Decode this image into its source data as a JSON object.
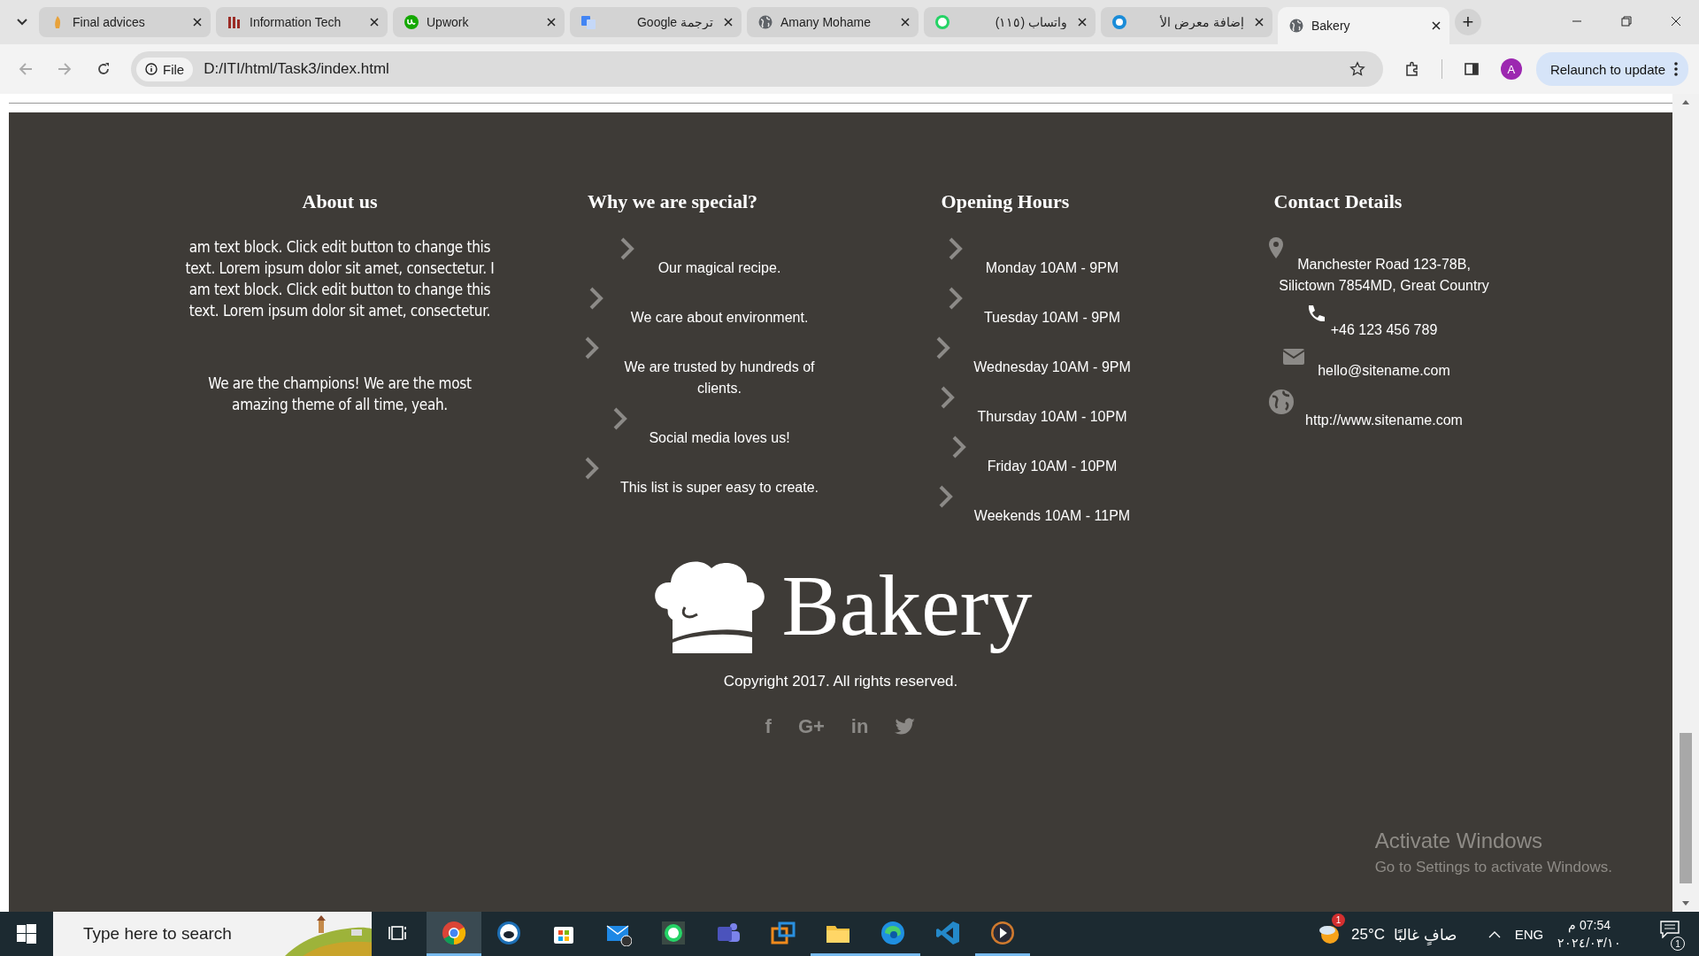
{
  "browser": {
    "tabs": [
      {
        "title": "Final advices",
        "selected": false
      },
      {
        "title": "Information Tech",
        "selected": false
      },
      {
        "title": "Upwork",
        "selected": false
      },
      {
        "title": "ترجمة Google",
        "selected": false
      },
      {
        "title": "Amany Mohame",
        "selected": false
      },
      {
        "title": "واتساب (١١٥)",
        "selected": false
      },
      {
        "title": "إضافة معرض الأ",
        "selected": false
      },
      {
        "title": "Bakery",
        "selected": true
      }
    ],
    "new_tab": "+",
    "address": {
      "chip": "File",
      "url": "D:/ITI/html/Task3/index.html"
    },
    "profile": "A",
    "relaunch": "Relaunch to update"
  },
  "footer": {
    "columns": [
      {
        "heading": "About us",
        "kind": "text",
        "paragraphs": [
          "am text block. Click edit button to change this text. Lorem ipsum dolor sit amet, consectetur. I am text block. Click edit button to change this text. Lorem ipsum dolor sit amet, consectetur.",
          "We are the champions! We are the most amazing theme of all time, yeah."
        ]
      },
      {
        "heading": "Why we are special?",
        "kind": "list",
        "items": [
          {
            "text": "Our magical recipe."
          },
          {
            "text": "We care about environment."
          },
          {
            "text": "We are trusted by hundreds of clients."
          },
          {
            "text": "Social media loves us!"
          },
          {
            "text": "This list is super easy to create."
          }
        ]
      },
      {
        "heading": "Opening Hours",
        "kind": "list",
        "items": [
          {
            "text": "Monday 10AM - 9PM"
          },
          {
            "text": "Tuesday 10AM - 9PM"
          },
          {
            "text": "Wednesday 10AM - 9PM"
          },
          {
            "text": "Thursday 10AM - 10PM"
          },
          {
            "text": "Friday 10AM - 10PM"
          },
          {
            "text": "Weekends 10AM - 11PM"
          }
        ]
      },
      {
        "heading": "Contact Details",
        "kind": "contact",
        "items": [
          {
            "kind": "pin",
            "text": "Manchester Road 123-78B, Silictown 7854MD, Great Country"
          },
          {
            "kind": "phone",
            "text": "+46 123 456 789"
          },
          {
            "kind": "mail",
            "text": "hello@sitename.com"
          },
          {
            "kind": "globe",
            "text": "http://www.sitename.com"
          }
        ]
      }
    ],
    "logo": "Bakery",
    "copyright": "Copyright 2017. All rights reserved.",
    "social": [
      {
        "kind": "glyph",
        "text": "f"
      },
      {
        "kind": "glyph",
        "text": "G+"
      },
      {
        "kind": "glyph",
        "text": "in"
      },
      {
        "kind": "bird"
      }
    ]
  },
  "activation": {
    "title": "Activate Windows",
    "subtitle": "Go to Settings to activate Windows."
  },
  "taskbar": {
    "search": {
      "placeholder": "Type here to search"
    },
    "apps": [
      {
        "kind": "taskview",
        "running": false,
        "selected": false
      },
      {
        "kind": "chrome",
        "running": true,
        "selected": true
      },
      {
        "kind": "helmet",
        "running": false,
        "selected": false
      },
      {
        "kind": "store",
        "running": false,
        "selected": false
      },
      {
        "kind": "mail",
        "running": false,
        "selected": false
      },
      {
        "kind": "whatsapp",
        "running": false,
        "selected": false
      },
      {
        "kind": "teams",
        "running": false,
        "selected": false
      },
      {
        "kind": "squares",
        "running": false,
        "selected": false
      },
      {
        "kind": "folder",
        "running": true,
        "selected": false
      },
      {
        "kind": "edge",
        "running": true,
        "selected": false
      },
      {
        "kind": "vscode",
        "running": false,
        "selected": false
      },
      {
        "kind": "player",
        "running": true,
        "selected": false
      }
    ],
    "weather": {
      "badge": "1",
      "temperature": "25°C",
      "condition": "صافٍ غالبًا"
    },
    "language": "ENG",
    "time": "07:54 م",
    "date": "٢٠٢٤/٠٣/١٠",
    "notifications": "1"
  }
}
